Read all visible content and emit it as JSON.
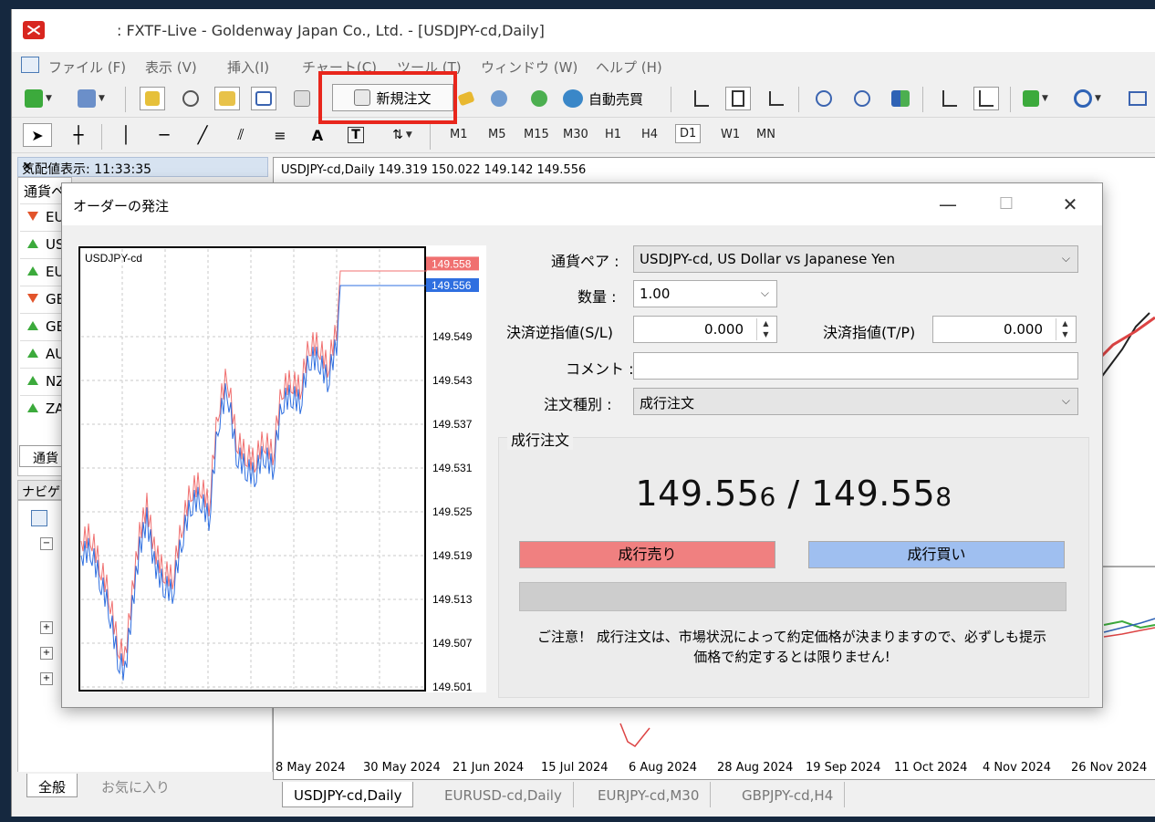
{
  "app": {
    "title": ": FXTF-Live - Goldenway Japan Co., Ltd. - [USDJPY-cd,Daily]"
  },
  "menu": [
    "ファイル (F)",
    "表示 (V)",
    "挿入(I)",
    "チャート(C)",
    "ツール (T)",
    "ウィンドウ (W)",
    "ヘルプ (H)"
  ],
  "toolbar": {
    "new_order_label": "新規注文",
    "auto_trade_label": "自動売買",
    "timeframes": [
      "M1",
      "M5",
      "M15",
      "M30",
      "H1",
      "H4",
      "D1",
      "W1",
      "MN"
    ],
    "active_timeframe": "D1",
    "text_tool_A": "A",
    "text_tool_T": "T"
  },
  "market_watch": {
    "title": "気配値表示: 11:33:35",
    "column": "通貨ペ",
    "rows": [
      {
        "symbol": "EU",
        "dir": "down"
      },
      {
        "symbol": "US",
        "dir": "up"
      },
      {
        "symbol": "EU",
        "dir": "up"
      },
      {
        "symbol": "GB",
        "dir": "down"
      },
      {
        "symbol": "GB",
        "dir": "up"
      },
      {
        "symbol": "AU",
        "dir": "up"
      },
      {
        "symbol": "NZ",
        "dir": "up"
      },
      {
        "symbol": "ZA",
        "dir": "up"
      }
    ],
    "tab": "通貨"
  },
  "navigator": {
    "title": "ナビゲー",
    "tabs": [
      "全般",
      "お気に入り"
    ]
  },
  "chart": {
    "header": "USDJPY-cd,Daily  149.319 150.022 149.142 149.556",
    "dates": [
      "8 May 2024",
      "30 May 2024",
      "21 Jun 2024",
      "15 Jul 2024",
      "6 Aug 2024",
      "28 Aug 2024",
      "19 Sep 2024",
      "11 Oct 2024",
      "4 Nov 2024",
      "26 Nov 2024"
    ],
    "tabs": [
      "USDJPY-cd,Daily",
      "EURUSD-cd,Daily",
      "EURJPY-cd,M30",
      "GBPJPY-cd,H4"
    ],
    "active_tab": "USDJPY-cd,Daily"
  },
  "dialog": {
    "title": "オーダーの発注",
    "mini_chart": {
      "symbol": "USDJPY-cd",
      "ask": "149.558",
      "bid": "149.556",
      "y_ticks": [
        "149.549",
        "149.543",
        "149.537",
        "149.531",
        "149.525",
        "149.519",
        "149.513",
        "149.507",
        "149.501"
      ],
      "ask_color": "#f07070",
      "bid_color": "#2f6fe0"
    },
    "symbol_label": "通貨ペア :",
    "symbol_value": "USDJPY-cd, US Dollar vs Japanese Yen",
    "volume_label": "数量 :",
    "volume_value": "1.00",
    "sl_label": "決済逆指値(S/L)",
    "sl_value": "0.000",
    "tp_label": "決済指値(T/P)",
    "tp_value": "0.000",
    "comment_label": "コメント :",
    "comment_value": "",
    "type_label": "注文種別 :",
    "type_value": "成行注文",
    "group_label": "成行注文",
    "bid_main": "149.55",
    "bid_small": "6",
    "separator": " / ",
    "ask_main": "149.55",
    "ask_small": "8",
    "sell_label": "成行売り",
    "buy_label": "成行買い",
    "notice_line1": "ご注意！ 成行注文は、市場状況によって約定価格が決まりますので、必ずしも提示",
    "notice_line2": "価格で約定するとは限りません!",
    "sell_color": "#f08080",
    "buy_color": "#9fbff0"
  }
}
